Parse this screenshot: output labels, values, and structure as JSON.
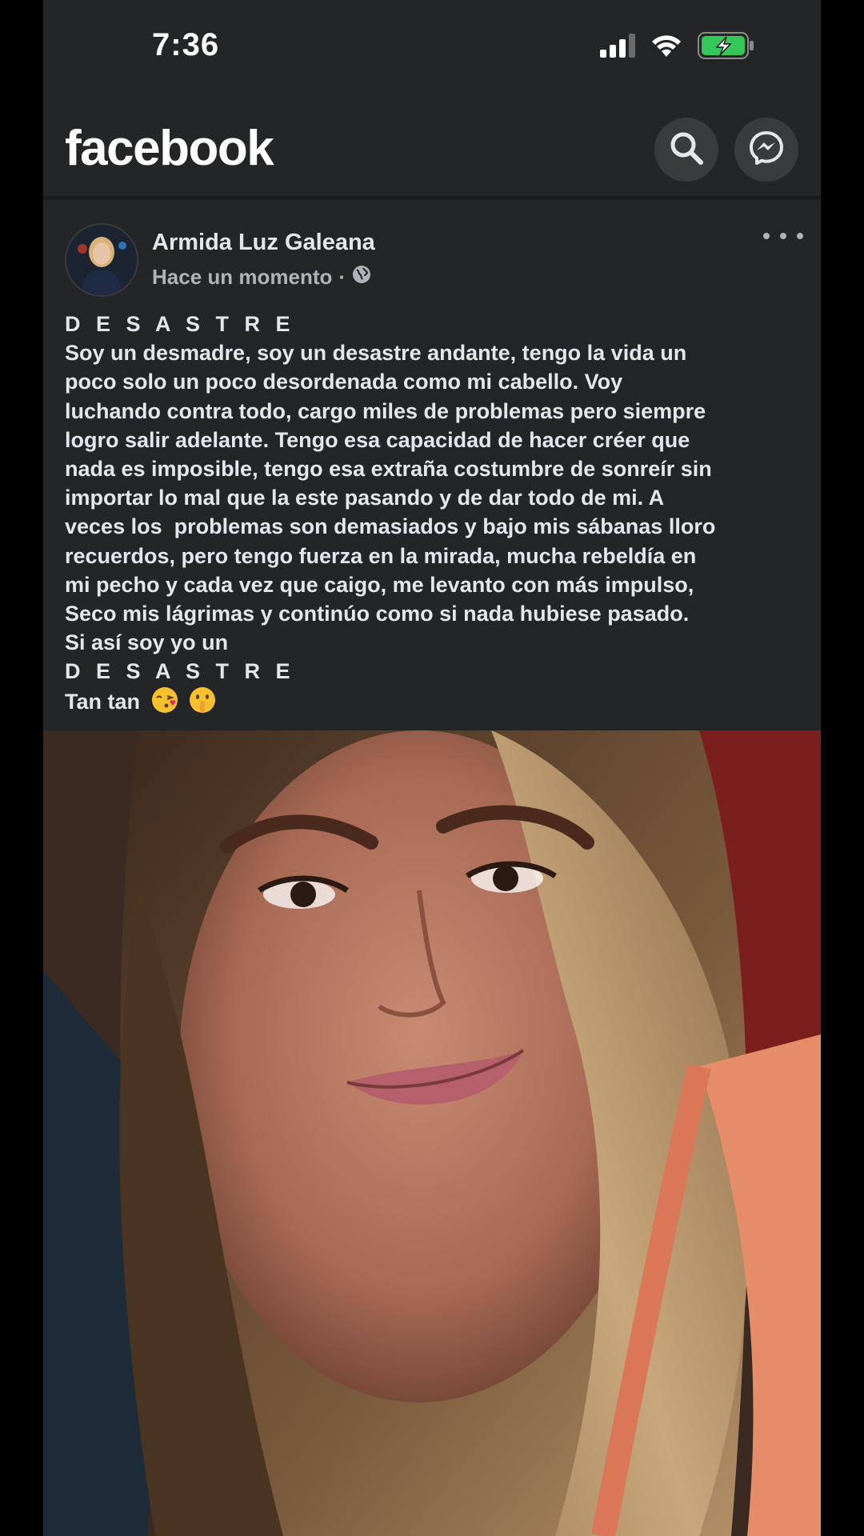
{
  "status_bar": {
    "time": "7:36",
    "icons": [
      "signal-icon",
      "wifi-icon",
      "battery-charging-icon"
    ],
    "battery_color": "#34c759"
  },
  "header": {
    "logo": "facebook",
    "search_icon": "search-icon",
    "messenger_icon": "messenger-icon"
  },
  "post": {
    "author": "Armida Luz Galeana",
    "time": "Hace un momento",
    "separator": "·",
    "privacy_icon": "globe-icon",
    "more_icon": "more-horizontal-icon",
    "lines": [
      "D E S A S T R E",
      "Soy un desmadre, soy un desastre andante, tengo la vida un",
      "poco solo un poco desordenada como mi cabello. Voy",
      "luchando contra todo, cargo miles de problemas pero siempre",
      "logro salir adelante. Tengo esa capacidad de hacer créer que",
      "nada es imposible, tengo esa extraña costumbre de sonreír sin",
      "importar lo mal que la este pasando y de dar todo de mi. A",
      "veces los  problemas son demasiados y bajo mis sábanas lloro",
      "recuerdos, pero tengo fuerza en la mirada, mucha rebeldía en",
      "mi pecho y cada vez que caigo, me levanto con más impulso,",
      "Seco mis lágrimas y continúo como si nada hubiese pasado.",
      "Si así soy yo un",
      "D E S A S T R E",
      "Tan tan"
    ],
    "emojis": [
      "kissing-face-emoji",
      "shushing-face-emoji"
    ],
    "photo": "selfie-photo"
  },
  "colors": {
    "background": "#242526",
    "text": "#e4e6eb",
    "secondary_text": "#b0b3b8",
    "button_bg": "#3a3b3c"
  }
}
